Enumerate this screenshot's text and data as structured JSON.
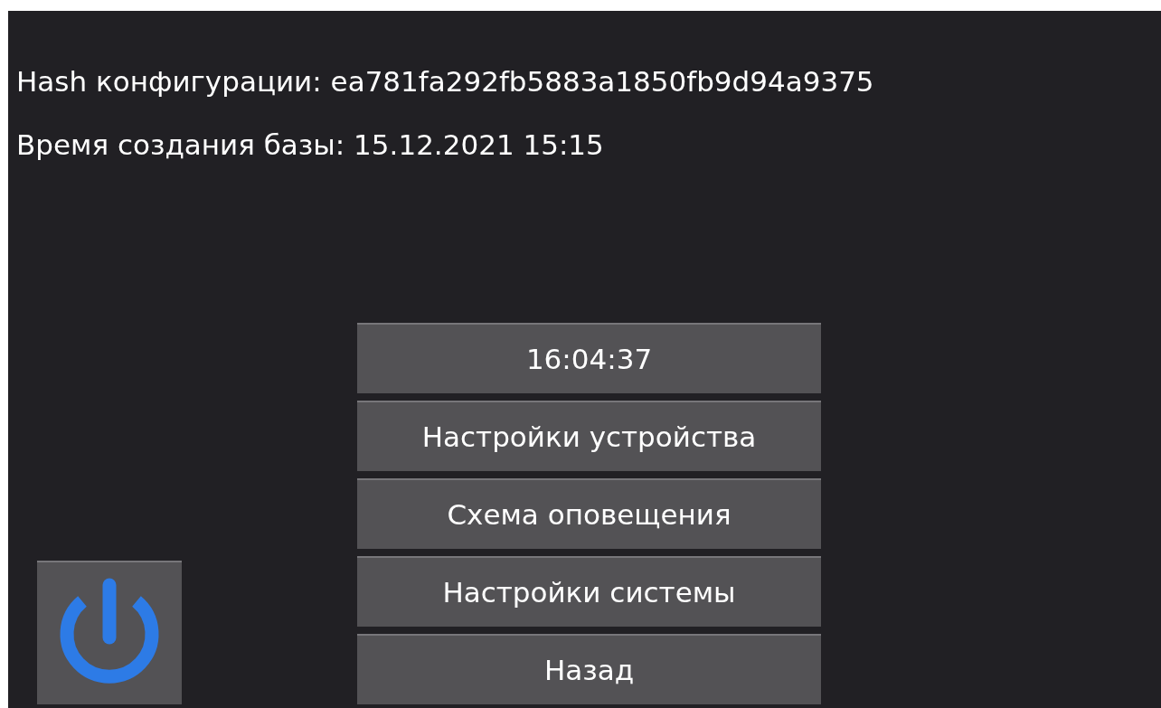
{
  "info_lines": [
    {
      "label": "Hash конфигурации:",
      "value": "ea781fa292fb5883a1850fb9d94a9375"
    },
    {
      "label": "Время создания базы:",
      "value": "15.12.2021 15:15"
    }
  ],
  "menu_buttons": [
    {
      "label": "16:04:37"
    },
    {
      "label": "Настройки устройства"
    },
    {
      "label": "Схема оповещения"
    },
    {
      "label": "Настройки системы"
    },
    {
      "label": "Назад"
    }
  ]
}
